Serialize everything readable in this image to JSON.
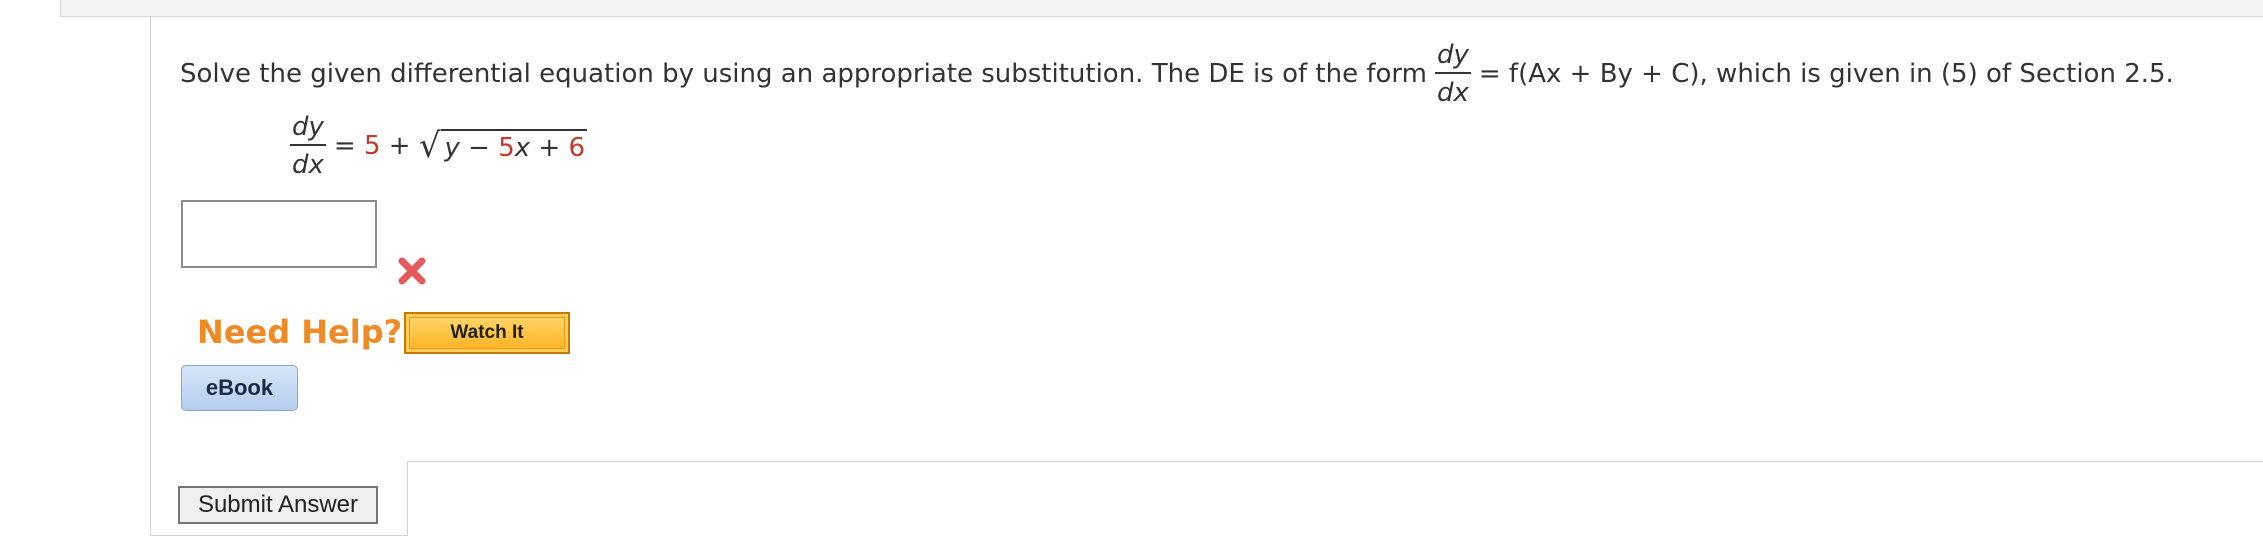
{
  "question": {
    "prompt_before": "Solve the given differential equation by using an appropriate substitution. The DE is of the form",
    "form_numerator": "dy",
    "form_denominator": "dx",
    "form_rhs": "= f(Ax + By + C), which is given in (5) of Section 2.5."
  },
  "equation": {
    "numerator": "dy",
    "denominator": "dx",
    "equals": "=",
    "const": "5",
    "plus": "+",
    "radicand_y": "y",
    "radicand_minus": "−",
    "radicand_coef": "5",
    "radicand_x": "x",
    "radicand_plus": "+",
    "radicand_const": "6"
  },
  "answer": {
    "value": "",
    "status_icon": "incorrect-x-icon",
    "status_color": "#e55b5b"
  },
  "help": {
    "label": "Need Help?",
    "watch_label": "Watch It",
    "ebook_label": "eBook"
  },
  "submit": {
    "label": "Submit Answer"
  },
  "colors": {
    "accent_orange": "#f08a24",
    "highlight_red": "#c0392b"
  }
}
